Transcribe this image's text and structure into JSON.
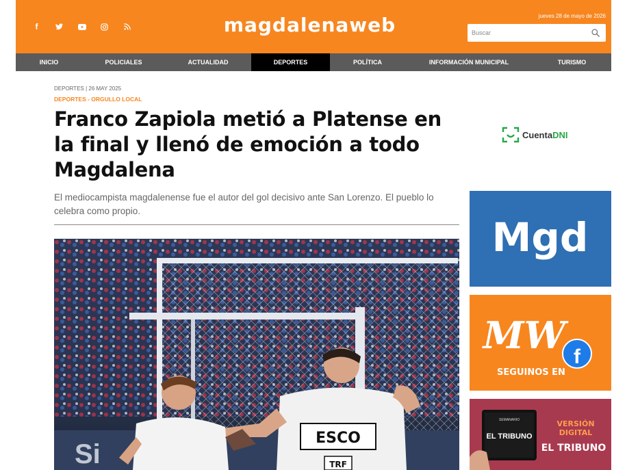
{
  "header": {
    "logo": "magdalenaweb",
    "date": "jueves 28 de mayo de 2026",
    "search": {
      "placeholder": "Buscar"
    },
    "social_icons": [
      "facebook-icon",
      "twitter-icon",
      "youtube-icon",
      "instagram-icon",
      "rss-icon"
    ]
  },
  "nav": {
    "items": [
      {
        "label": "INICIO"
      },
      {
        "label": "POLICIALES"
      },
      {
        "label": "ACTUALIDAD"
      },
      {
        "label": "DEPORTES"
      },
      {
        "label": "POLÍTICA"
      },
      {
        "label": "INFORMACIÓN MUNICIPAL"
      },
      {
        "label": "TURISMO"
      }
    ],
    "active": "DEPORTES"
  },
  "article": {
    "meta": "DEPORTES | 26 MAY 2025",
    "categories": "DEPORTES - ORGULLO LOCAL",
    "title": "Franco Zapiola metió a Platense en la final y llenó de emoción a todo Magdalena",
    "subtitle": "El mediocampista magdalenense fue el autor del gol decisivo ante San Lorenzo. El pueblo lo celebra como propio.",
    "photo": {
      "jersey_text": "ESCO",
      "jersey_text_2": "TRF",
      "ad_board_text": "Si"
    }
  },
  "sidebar": {
    "cuentadni": {
      "prefix": "Cuenta",
      "suffix": "DNI"
    },
    "ad_mgd": {
      "text": "Mgd"
    },
    "ad_mw": {
      "logo": "MW",
      "caption": "SEGUINOS EN",
      "fb": "f"
    },
    "ad_tribuno": {
      "paper_top": "SEMANARIO",
      "paper_name": "EL TRIBUNO",
      "line1": "VERSIÓN",
      "line2": "DIGITAL",
      "line3": "EL TRIBUNO"
    }
  },
  "colors": {
    "brand_orange": "#f7861f",
    "nav_gray": "#5b5b5b",
    "nav_active": "#000000",
    "mgd_blue": "#2f6fb3",
    "tribuno_red": "#a83a50",
    "cuentadni_green": "#27a844"
  }
}
